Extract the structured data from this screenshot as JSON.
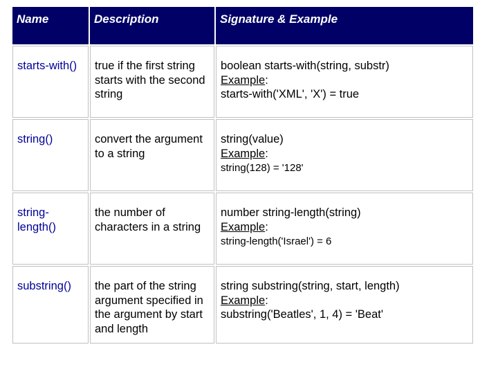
{
  "headers": {
    "name": "Name",
    "desc": "Description",
    "sig": "Signature & Example"
  },
  "rows": [
    {
      "name": "starts-with()",
      "desc": "true if the first string starts with the second string",
      "sig": "boolean  starts-with(string, substr)",
      "ex_label": "Example",
      "ex": "starts-with('XML', 'X') = true",
      "ex_small": false
    },
    {
      "name": "string()",
      "desc": "convert the argument to a string",
      "sig": "string(value)",
      "ex_label": "Example",
      "ex": "string(128) = '128'",
      "ex_small": true
    },
    {
      "name": "string-length()",
      "desc": "the number of characters in a string",
      "sig": "number string-length(string)",
      "ex_label": "Example",
      "ex": "string-length('Israel') = 6",
      "ex_small": true
    },
    {
      "name": "substring()",
      "desc": "the part of the string  argument specified in the argument by start and length",
      "sig": "string substring(string, start, length)",
      "ex_label": "Example",
      "ex": "substring('Beatles', 1, 4) = 'Beat'",
      "ex_small": false
    }
  ]
}
